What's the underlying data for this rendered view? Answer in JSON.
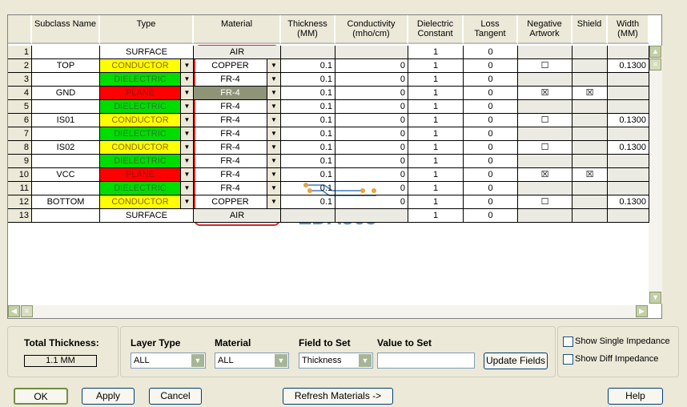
{
  "columns": [
    "",
    "Subclass Name",
    "Type",
    "Material",
    "Thickness\n(MM)",
    "Conductivity\n(mho/cm)",
    "Dielectric\nConstant",
    "Loss\nTangent",
    "Negative\nArtwork",
    "Shield",
    "Width\n(MM)"
  ],
  "rows": [
    {
      "n": "1",
      "name": "",
      "type": "SURFACE",
      "material": "AIR",
      "thickness": "",
      "cond": "",
      "diel": "1",
      "loss": "0",
      "neg": null,
      "shield": null,
      "width": ""
    },
    {
      "n": "2",
      "name": "TOP",
      "type": "CONDUCTOR",
      "material": "COPPER",
      "thickness": "0.1",
      "cond": "0",
      "diel": "1",
      "loss": "0",
      "neg": false,
      "shield": null,
      "width": "0.1300"
    },
    {
      "n": "3",
      "name": "",
      "type": "DIELECTRIC",
      "material": "FR-4",
      "thickness": "0.1",
      "cond": "0",
      "diel": "1",
      "loss": "0",
      "neg": null,
      "shield": null,
      "width": ""
    },
    {
      "n": "4",
      "name": "GND",
      "type": "PLANE",
      "material": "FR-4",
      "thickness": "0.1",
      "cond": "0",
      "diel": "1",
      "loss": "0",
      "neg": true,
      "shield": true,
      "width": "",
      "selected": true
    },
    {
      "n": "5",
      "name": "",
      "type": "DIELECTRIC",
      "material": "FR-4",
      "thickness": "0.1",
      "cond": "0",
      "diel": "1",
      "loss": "0",
      "neg": null,
      "shield": null,
      "width": ""
    },
    {
      "n": "6",
      "name": "IS01",
      "type": "CONDUCTOR",
      "material": "FR-4",
      "thickness": "0.1",
      "cond": "0",
      "diel": "1",
      "loss": "0",
      "neg": false,
      "shield": null,
      "width": "0.1300"
    },
    {
      "n": "7",
      "name": "",
      "type": "DIELECTRIC",
      "material": "FR-4",
      "thickness": "0.1",
      "cond": "0",
      "diel": "1",
      "loss": "0",
      "neg": null,
      "shield": null,
      "width": ""
    },
    {
      "n": "8",
      "name": "IS02",
      "type": "CONDUCTOR",
      "material": "FR-4",
      "thickness": "0.1",
      "cond": "0",
      "diel": "1",
      "loss": "0",
      "neg": false,
      "shield": null,
      "width": "0.1300"
    },
    {
      "n": "9",
      "name": "",
      "type": "DIELECTRIC",
      "material": "FR-4",
      "thickness": "0.1",
      "cond": "0",
      "diel": "1",
      "loss": "0",
      "neg": null,
      "shield": null,
      "width": ""
    },
    {
      "n": "10",
      "name": "VCC",
      "type": "PLANE",
      "material": "FR-4",
      "thickness": "0.1",
      "cond": "0",
      "diel": "1",
      "loss": "0",
      "neg": true,
      "shield": true,
      "width": ""
    },
    {
      "n": "11",
      "name": "",
      "type": "DIELECTRIC",
      "material": "FR-4",
      "thickness": "0.1",
      "cond": "0",
      "diel": "1",
      "loss": "0",
      "neg": null,
      "shield": null,
      "width": ""
    },
    {
      "n": "12",
      "name": "BOTTOM",
      "type": "CONDUCTOR",
      "material": "COPPER",
      "thickness": "0.1",
      "cond": "0",
      "diel": "1",
      "loss": "0",
      "neg": false,
      "shield": null,
      "width": "0.1300"
    },
    {
      "n": "13",
      "name": "",
      "type": "SURFACE",
      "material": "AIR",
      "thickness": "",
      "cond": "",
      "diel": "1",
      "loss": "0",
      "neg": null,
      "shield": null,
      "width": ""
    }
  ],
  "type_colors": {
    "CONDUCTOR": "#ffff00",
    "DIELECTRIC": "#00dd00",
    "PLANE": "#ff0000",
    "SURFACE": "#ffffff"
  },
  "highlight_color": "#d6262b",
  "watermark": "EDA365",
  "bottom": {
    "total_label": "Total Thickness:",
    "total_value": "1.1 MM",
    "layer_type_label": "Layer Type",
    "layer_type_value": "ALL",
    "material_label": "Material",
    "material_value": "ALL",
    "field_label": "Field to Set",
    "field_value": "Thickness",
    "value_label": "Value to Set",
    "value_value": "",
    "update": "Update Fields",
    "single_imp": "Show Single Impedance",
    "diff_imp": "Show Diff Impedance"
  },
  "buttons": {
    "ok": "OK",
    "apply": "Apply",
    "cancel": "Cancel",
    "refresh": "Refresh Materials ->",
    "help": "Help"
  }
}
